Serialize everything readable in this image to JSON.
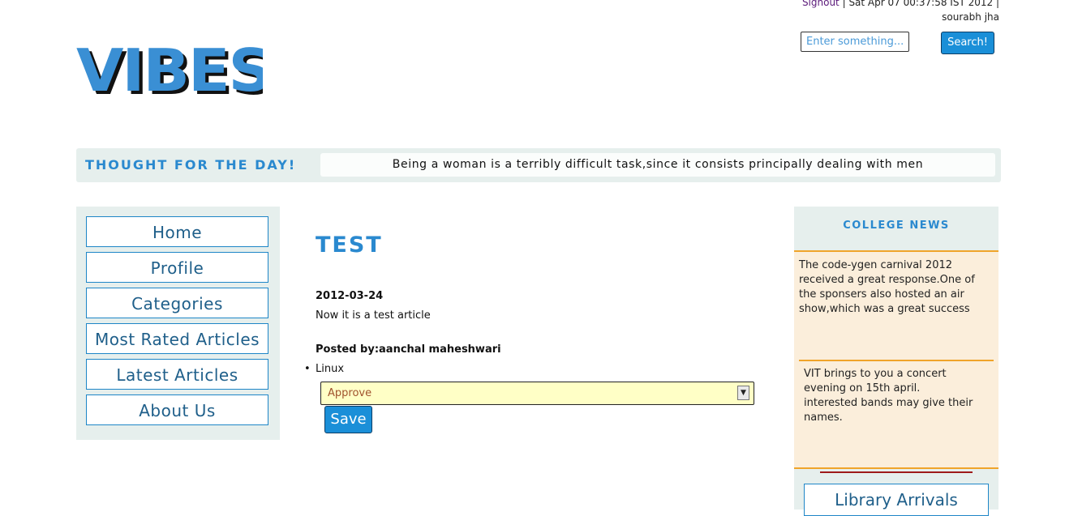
{
  "header": {
    "signout_label": "Signout",
    "datetime": " | Sat Apr 07 00:37:58 IST 2012 |",
    "username": "sourabh jha",
    "search": {
      "placeholder": "Enter something...",
      "button_label": "Search!"
    },
    "logo_text": "VIBES"
  },
  "thought": {
    "title": "Thought for the day!",
    "text": "Being a woman is a terribly difficult task,since it consists principally dealing with men"
  },
  "nav": {
    "items": [
      {
        "label": "Home"
      },
      {
        "label": "Profile"
      },
      {
        "label": "Categories"
      },
      {
        "label": "Most Rated Articles"
      },
      {
        "label": "Latest Articles"
      },
      {
        "label": "About Us"
      }
    ]
  },
  "article": {
    "title": "TEST",
    "date": "2012-03-24",
    "body": "Now it is a test article",
    "posted_by": "Posted by:aanchal maheshwari",
    "category": "Linux",
    "status_select": {
      "selected": "Approve"
    },
    "save_label": "Save"
  },
  "news": {
    "title": "College News",
    "items": [
      {
        "text": "The code-ygen carnival 2012 received a great response.One of the sponsers also hosted an air show,which was a great success"
      },
      {
        "text": "VIT brings to you a concert evening on 15th april. interested bands may give their names."
      }
    ],
    "library_label": "Library Arrivals"
  },
  "colors": {
    "accent": "#2a89cf",
    "panel": "#e6efed",
    "news_bg": "#fbeedb",
    "news_border": "#f0a42a",
    "button": "#1a8fd8"
  }
}
